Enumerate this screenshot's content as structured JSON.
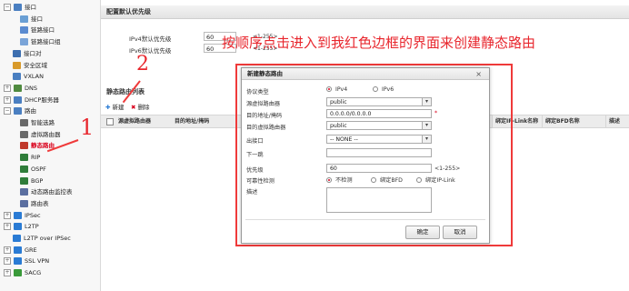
{
  "sidebar": {
    "items": [
      {
        "label": "接口",
        "expander": "−",
        "icon": "interface-icon",
        "indent": 0
      },
      {
        "label": "接口",
        "expander": "",
        "icon": "interface-icon",
        "indent": 1
      },
      {
        "label": "链路接口",
        "expander": "",
        "icon": "link-icon",
        "indent": 1
      },
      {
        "label": "链路接口组",
        "expander": "",
        "icon": "link-group-icon",
        "indent": 1
      },
      {
        "label": "接口对",
        "expander": "",
        "icon": "interface-pair-icon",
        "indent": 0
      },
      {
        "label": "安全区域",
        "expander": "",
        "icon": "security-zone-icon",
        "indent": 0
      },
      {
        "label": "VXLAN",
        "expander": "",
        "icon": "vxlan-icon",
        "indent": 0
      },
      {
        "label": "DNS",
        "expander": "+",
        "icon": "dns-icon",
        "indent": 0
      },
      {
        "label": "DHCP服务器",
        "expander": "+",
        "icon": "dhcp-icon",
        "indent": 0
      },
      {
        "label": "路由",
        "expander": "−",
        "icon": "route-icon",
        "indent": 0
      },
      {
        "label": "智能选路",
        "expander": "",
        "icon": "smart-route-icon",
        "indent": 1
      },
      {
        "label": "虚拟路由器",
        "expander": "",
        "icon": "virtual-router-icon",
        "indent": 1
      },
      {
        "label": "静态路由",
        "expander": "",
        "icon": "static-route-icon",
        "indent": 1,
        "active": true
      },
      {
        "label": "RIP",
        "expander": "",
        "icon": "rip-icon",
        "indent": 1
      },
      {
        "label": "OSPF",
        "expander": "",
        "icon": "ospf-icon",
        "indent": 1
      },
      {
        "label": "BGP",
        "expander": "",
        "icon": "bgp-icon",
        "indent": 1
      },
      {
        "label": "动态路由监控表",
        "expander": "",
        "icon": "monitor-icon",
        "indent": 1
      },
      {
        "label": "路由表",
        "expander": "",
        "icon": "route-table-icon",
        "indent": 1
      },
      {
        "label": "IPSec",
        "expander": "+",
        "icon": "ipsec-icon",
        "indent": 0
      },
      {
        "label": "L2TP",
        "expander": "+",
        "icon": "l2tp-icon",
        "indent": 0
      },
      {
        "label": "L2TP over IPSec",
        "expander": "",
        "icon": "l2tp-ipsec-icon",
        "indent": 0
      },
      {
        "label": "GRE",
        "expander": "+",
        "icon": "gre-icon",
        "indent": 0
      },
      {
        "label": "SSL VPN",
        "expander": "+",
        "icon": "sslvpn-icon",
        "indent": 0
      },
      {
        "label": "SACG",
        "expander": "+",
        "icon": "sacg-icon",
        "indent": 0
      }
    ]
  },
  "priority_panel": {
    "title": "配置默认优先级",
    "ipv4_label": "IPv4默认优先级",
    "ipv4_value": "60",
    "ipv4_hint": "<1-255>",
    "ipv6_label": "IPv6默认优先级",
    "ipv6_value": "60",
    "ipv6_hint": "<1-255>"
  },
  "route_list": {
    "title": "静态路由列表",
    "new_label": "新建",
    "delete_label": "删除",
    "columns": [
      "源虚拟路由器",
      "目的地址/掩码",
      "绑定IP-Link名称",
      "绑定BFD名称",
      "描述"
    ]
  },
  "annotations": {
    "instruction": "按顺序点击进入到我红色边框的界面来创建静态路由",
    "step1": "1",
    "step2": "2"
  },
  "dialog": {
    "title": "新建静态路由",
    "close": "×",
    "protocol_label": "协议类型",
    "protocol_options": [
      "IPv4",
      "IPv6"
    ],
    "protocol_selected": "IPv4",
    "src_router_label": "源虚拟路由器",
    "src_router_value": "public",
    "dest_label": "目的地址/掩码",
    "dest_value": "0.0.0.0/0.0.0.0",
    "required_mark": "*",
    "dest_router_label": "目的虚拟路由器",
    "dest_router_value": "public",
    "egress_label": "出接口",
    "egress_value": "-- NONE --",
    "nexthop_label": "下一跳",
    "nexthop_value": "",
    "priority_label": "优先级",
    "priority_value": "60",
    "priority_hint": "<1-255>",
    "reliability_label": "可靠性检测",
    "reliability_options": [
      "不检测",
      "绑定BFD",
      "绑定IP-Link"
    ],
    "reliability_selected": "不检测",
    "desc_label": "描述",
    "desc_value": "",
    "ok_label": "确定",
    "cancel_label": "取消"
  },
  "colors": {
    "accent_red": "#e8262d",
    "active_item": "#d9001b"
  }
}
